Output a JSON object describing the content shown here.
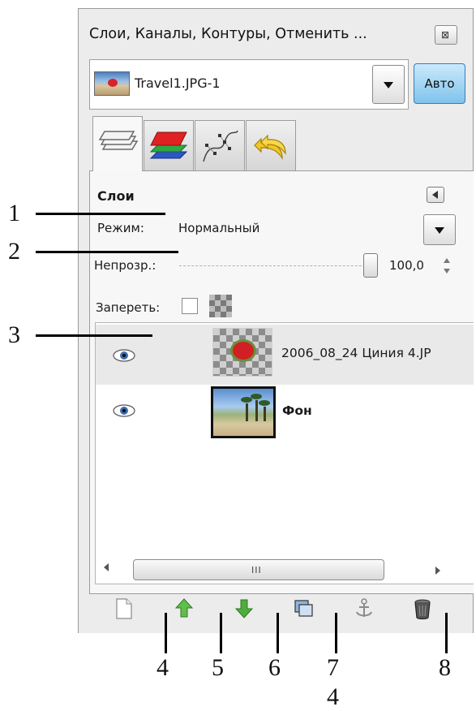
{
  "window": {
    "title": "Слои, Каналы, Контуры, Отменить ...",
    "close_glyph": "⊠"
  },
  "image_selector": {
    "value": "Travel1.JPG-1",
    "auto_label": "Авто"
  },
  "tabs": [
    {
      "name": "layers",
      "icon": "layers-icon",
      "active": true
    },
    {
      "name": "channels",
      "icon": "channels-icon",
      "active": false
    },
    {
      "name": "paths",
      "icon": "paths-icon",
      "active": false
    },
    {
      "name": "undo",
      "icon": "undo-history-icon",
      "active": false
    }
  ],
  "layers_panel": {
    "heading": "Слои",
    "mode_label": "Режим:",
    "mode_value": "Нормальный",
    "opacity_label": "Непрозр.:",
    "opacity_value": "100,0",
    "opacity_fraction": 1.0,
    "lock_label": "Запереть:",
    "layers": [
      {
        "name": "2006_08_24 Циния 4.JP",
        "visible": true,
        "selected": true,
        "bold": false
      },
      {
        "name": "Фон",
        "visible": true,
        "selected": false,
        "bold": true
      }
    ],
    "scrollbar_grip": "III"
  },
  "toolbar": [
    {
      "name": "new-layer-icon"
    },
    {
      "name": "raise-layer-icon"
    },
    {
      "name": "lower-layer-icon"
    },
    {
      "name": "duplicate-layer-icon"
    },
    {
      "name": "anchor-layer-icon"
    },
    {
      "name": "delete-layer-icon"
    }
  ],
  "callouts": {
    "left": [
      "1",
      "2",
      "3"
    ],
    "bottom": [
      "4",
      "5",
      "6",
      "7",
      "8"
    ],
    "figure_number": "4"
  },
  "colors": {
    "panel_bg": "#ececec",
    "auto_button": "#7fc3ec",
    "raise_arrow": "#5fbf4a",
    "lower_arrow": "#4fae3b"
  }
}
